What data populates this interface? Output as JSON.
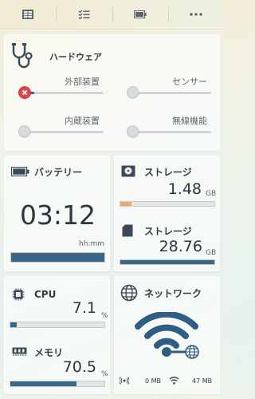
{
  "toolbar": {
    "tabs": [
      {
        "icon": "table-icon"
      },
      {
        "icon": "checklist-icon"
      },
      {
        "icon": "battery-icon"
      },
      {
        "icon": "more-icon"
      }
    ]
  },
  "hardware": {
    "title": "ハードウェア",
    "toggles": [
      {
        "label": "外部装置",
        "state": "error",
        "level": 0.18
      },
      {
        "label": "センサー",
        "state": "off",
        "level": 0
      },
      {
        "label": "内蔵装置",
        "state": "off",
        "level": 0
      },
      {
        "label": "無線機能",
        "state": "off",
        "level": 0
      }
    ]
  },
  "battery": {
    "title": "バッテリー",
    "time": "03:12",
    "time_unit": "hh:mm",
    "level": 1.0
  },
  "storage": {
    "items": [
      {
        "title": "ストレージ",
        "value": "1.48",
        "unit": "GB",
        "level": 0.12,
        "color": "#f0a873"
      },
      {
        "title": "ストレージ",
        "value": "28.76",
        "unit": "GB",
        "level": 1.0,
        "color": "#3a6688"
      }
    ]
  },
  "cpu": {
    "title": "CPU",
    "value": "7.1",
    "unit": "%",
    "level": 0.071
  },
  "memory": {
    "title": "メモリ",
    "value": "70.5",
    "unit": "%",
    "level": 0.705
  },
  "network": {
    "title": "ネットワーク",
    "rx": "0 MB",
    "tx": "47 MB"
  },
  "colors": {
    "accent": "#2f5d83",
    "error": "#e0454a",
    "storage_low": "#f0a873"
  }
}
